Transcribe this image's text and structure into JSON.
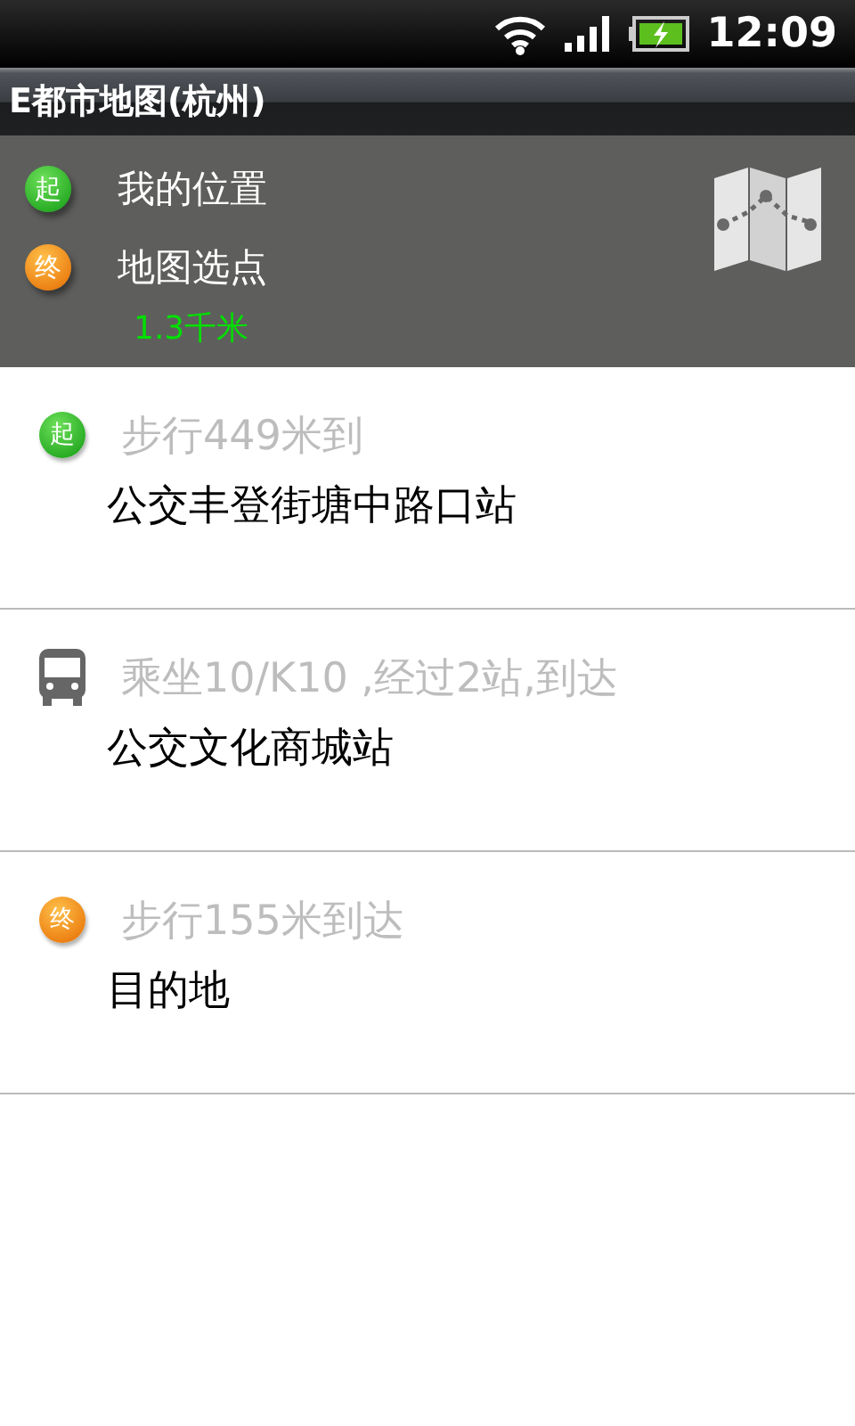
{
  "status_bar": {
    "time": "12:09"
  },
  "window": {
    "title": "E都市地图(杭州)"
  },
  "route": {
    "start": {
      "badge": "起",
      "label": "我的位置"
    },
    "end": {
      "badge": "终",
      "label": "地图选点"
    },
    "distance": "1.3千米"
  },
  "steps": [
    {
      "kind": "start",
      "badge": "起",
      "instruction": "步行449米到",
      "place": "公交丰登街塘中路口站"
    },
    {
      "kind": "bus",
      "instruction": "乘坐10/K10 ,经过2站,到达",
      "place": "公交文化商城站"
    },
    {
      "kind": "end",
      "badge": "终",
      "instruction": "步行155米到达",
      "place": "目的地"
    }
  ]
}
